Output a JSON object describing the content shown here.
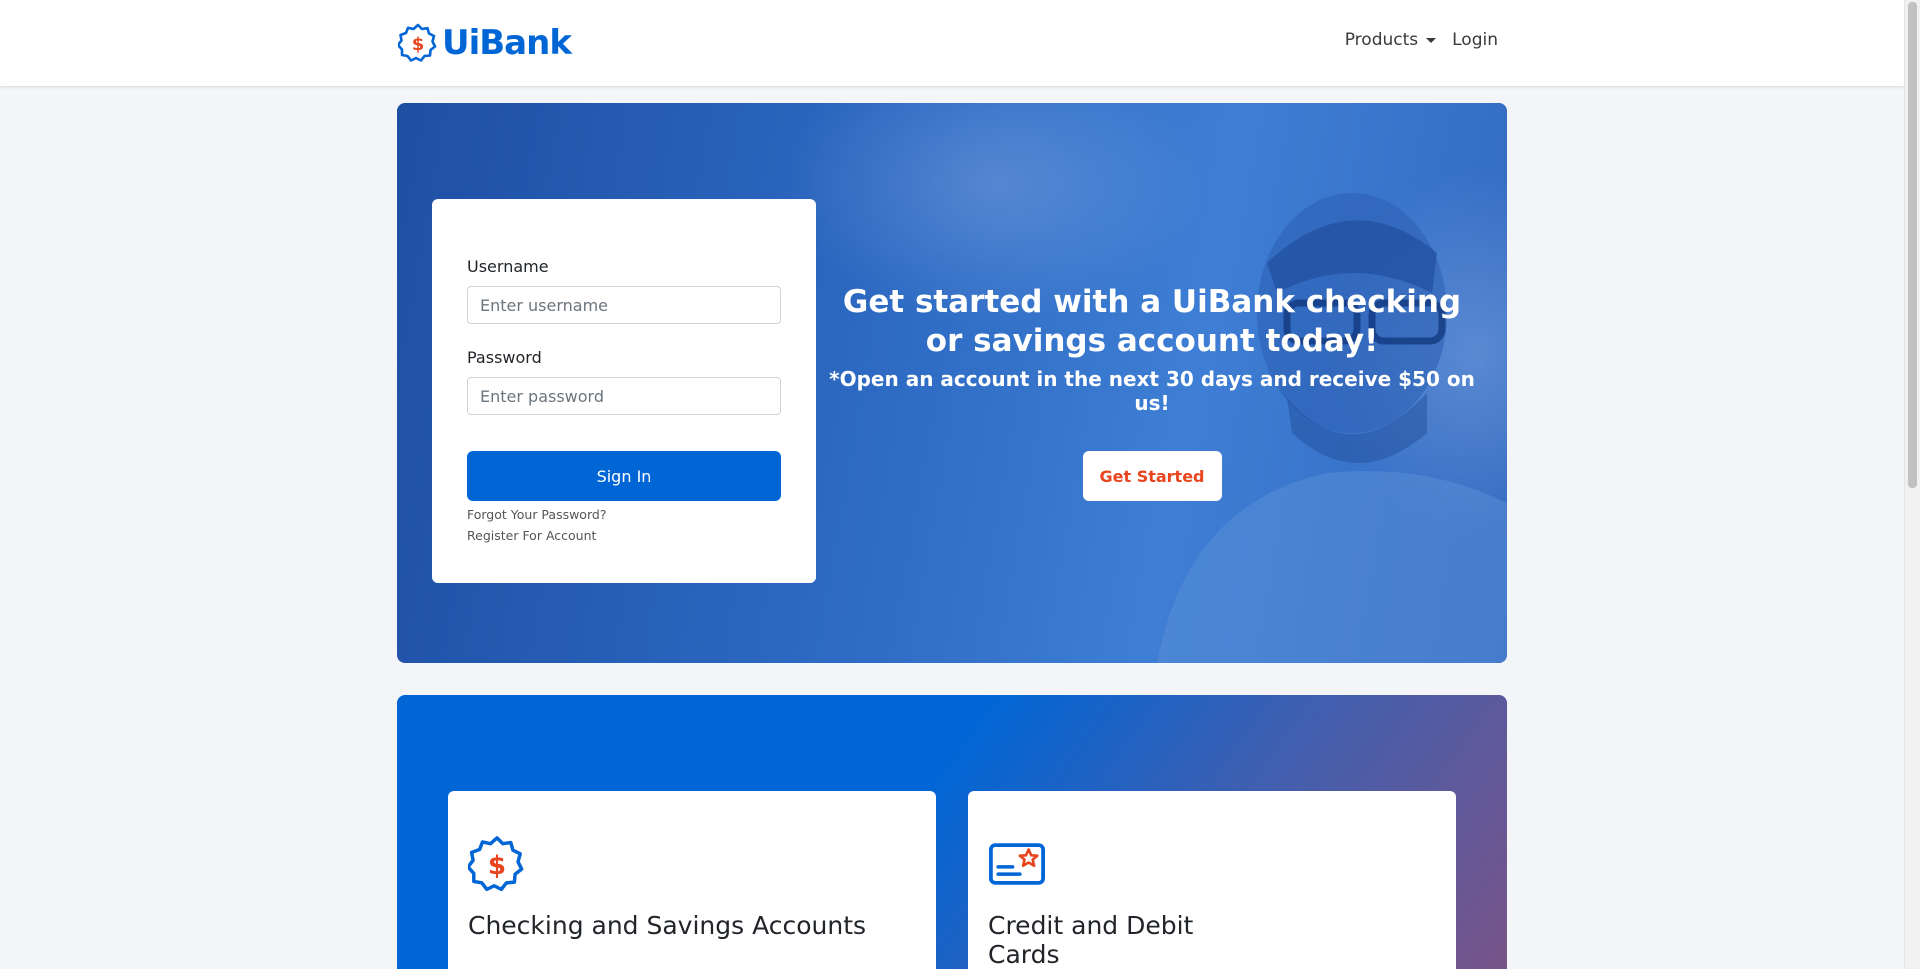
{
  "navbar": {
    "brand": "UiBank",
    "links": {
      "products": "Products",
      "login": "Login"
    }
  },
  "login": {
    "username_label": "Username",
    "username_placeholder": "Enter username",
    "password_label": "Password",
    "password_placeholder": "Enter password",
    "signin_label": "Sign In",
    "forgot_link": "Forgot Your Password?",
    "register_link": "Register For Account"
  },
  "hero": {
    "title": "Get started with a UiBank checking or savings account today!",
    "subtitle": "*Open an account in the next 30 days and receive $50 on us!",
    "cta_label": "Get Started"
  },
  "products": {
    "cards": [
      {
        "title": "Checking and Savings Accounts",
        "icon": "dollar-badge-icon"
      },
      {
        "title": "Credit and Debit Cards",
        "icon": "credit-card-icon"
      }
    ]
  },
  "colors": {
    "brand_blue": "#0066d6",
    "accent_orange": "#e8451e"
  }
}
